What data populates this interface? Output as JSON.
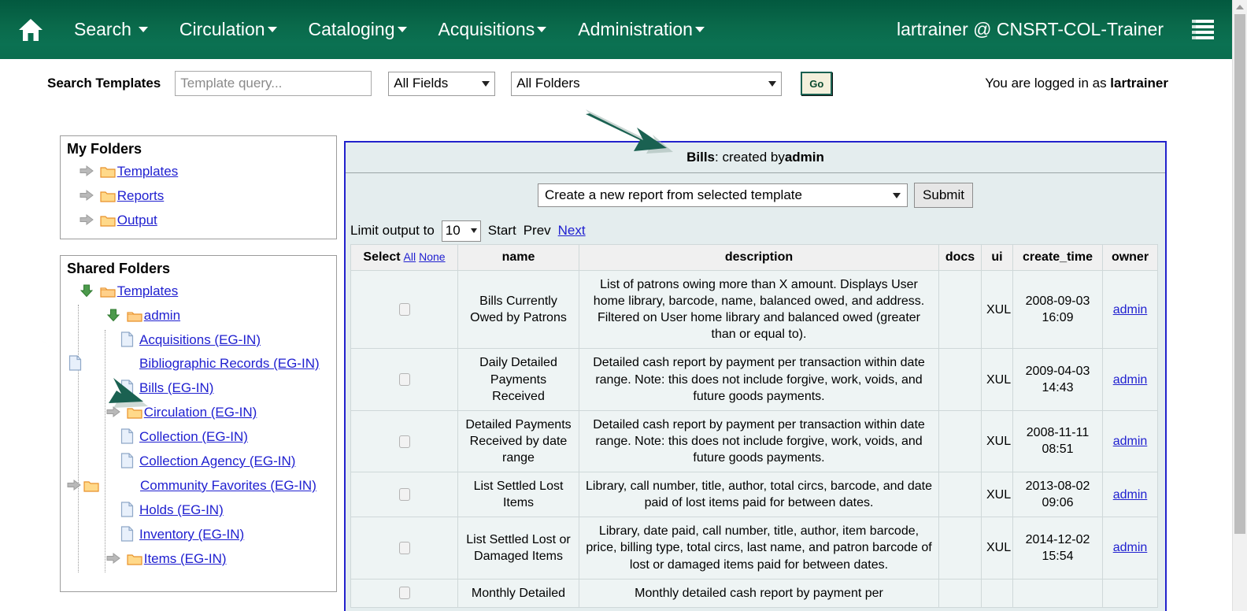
{
  "navbar": {
    "home_icon": "home-icon",
    "menu_icon": "list-menu-icon",
    "items": [
      {
        "label": "Search",
        "has_caret": true
      },
      {
        "label": "Circulation",
        "has_caret": true
      },
      {
        "label": "Cataloging",
        "has_caret": true
      },
      {
        "label": "Acquisitions",
        "has_caret": true
      },
      {
        "label": "Administration",
        "has_caret": true
      }
    ],
    "user": "lartrainer @ CNSRT-COL-Trainer"
  },
  "search": {
    "label": "Search Templates",
    "query_value": "",
    "query_placeholder": "Template query...",
    "fields_select": "All Fields",
    "folders_select": "All Folders",
    "go_label": "Go",
    "logged_in_prefix": "You are logged in as ",
    "logged_in_user": "lartrainer"
  },
  "my_folders": {
    "title": "My Folders",
    "items": [
      {
        "label": "Templates",
        "icon": "folder-icon",
        "toggle": "arrow-right-icon"
      },
      {
        "label": "Reports",
        "icon": "folder-icon",
        "toggle": "arrow-right-icon"
      },
      {
        "label": "Output",
        "icon": "folder-icon",
        "toggle": "arrow-right-icon"
      }
    ]
  },
  "shared_folders": {
    "title": "Shared Folders",
    "items": [
      {
        "label": "Templates",
        "icon": "folder-icon",
        "toggle": "arrow-down-icon",
        "depth": 0
      },
      {
        "label": "admin",
        "icon": "folder-icon",
        "toggle": "arrow-down-icon",
        "depth": 1
      },
      {
        "label": "Acquisitions (EG-IN)",
        "icon": "document-icon",
        "toggle": "none",
        "depth": 2
      },
      {
        "label": "Bibliographic Records (EG-IN)",
        "icon": "document-icon",
        "toggle": "none",
        "depth": 2
      },
      {
        "label": "Bills (EG-IN)",
        "icon": "document-icon",
        "toggle": "none",
        "depth": 2
      },
      {
        "label": "Circulation (EG-IN)",
        "icon": "folder-icon",
        "toggle": "arrow-right-icon",
        "depth": 2
      },
      {
        "label": "Collection (EG-IN)",
        "icon": "document-icon",
        "toggle": "none",
        "depth": 2
      },
      {
        "label": "Collection Agency (EG-IN)",
        "icon": "document-icon",
        "toggle": "none",
        "depth": 2
      },
      {
        "label": "Community Favorites (EG-IN)",
        "icon": "folder-icon",
        "toggle": "arrow-right-icon",
        "depth": 2
      },
      {
        "label": "Holds (EG-IN)",
        "icon": "document-icon",
        "toggle": "none",
        "depth": 2
      },
      {
        "label": "Inventory (EG-IN)",
        "icon": "document-icon",
        "toggle": "none",
        "depth": 2
      },
      {
        "label": "Items (EG-IN)",
        "icon": "folder-icon",
        "toggle": "arrow-right-icon",
        "depth": 2
      }
    ]
  },
  "main": {
    "heading_folder": "Bills",
    "heading_rest": ": created by ",
    "heading_owner": "admin",
    "action_select": "Create a new report from selected template",
    "submit_label": "Submit",
    "limit_label": "Limit output to",
    "limit_value": "10",
    "page_start": "Start",
    "page_prev": "Prev",
    "page_next": "Next",
    "columns": {
      "select": "Select",
      "select_all": "All",
      "select_none": "None",
      "name": "name",
      "description": "description",
      "docs": "docs",
      "ui": "ui",
      "create_time": "create_time",
      "owner": "owner"
    },
    "rows": [
      {
        "name": "Bills Currently Owed by Patrons",
        "description": "List of patrons owing more than X amount. Displays User home library, barcode, name, balanced owed, and address. Filtered on User home library and balanced owed (greater than or equal to).",
        "docs": "",
        "ui": "XUL",
        "create_time": "2008-09-03 16:09",
        "owner": "admin"
      },
      {
        "name": "Daily Detailed Payments Received",
        "description": "Detailed cash report by payment per transaction within date range. Note: this does not include forgive, work, voids, and future goods payments.",
        "docs": "",
        "ui": "XUL",
        "create_time": "2009-04-03 14:43",
        "owner": "admin"
      },
      {
        "name": "Detailed Payments Received by date range",
        "description": "Detailed cash report by payment per transaction within date range. Note: this does not include forgive, work, voids, and future goods payments.",
        "docs": "",
        "ui": "XUL",
        "create_time": "2008-11-11 08:51",
        "owner": "admin"
      },
      {
        "name": "List Settled Lost Items",
        "description": "Library, call number, title, author, total circs, barcode, and date paid of lost items paid for between dates.",
        "docs": "",
        "ui": "XUL",
        "create_time": "2013-08-02 09:06",
        "owner": "admin"
      },
      {
        "name": "List Settled Lost or Damaged Items",
        "description": "Library, date paid, call number, title, author, item barcode, price, billing type, total circs, last name, and patron barcode of lost or damaged items paid for between dates.",
        "docs": "",
        "ui": "XUL",
        "create_time": "2014-12-02 15:54",
        "owner": "admin"
      },
      {
        "name": "Monthly Detailed",
        "description": "Monthly detailed cash report by payment per",
        "docs": "",
        "ui": "",
        "create_time": "",
        "owner": ""
      }
    ]
  },
  "annotations": [
    {
      "name": "arrow-to-heading",
      "color": "#1a6151"
    },
    {
      "name": "arrow-to-bills-template",
      "color": "#1a6151"
    }
  ],
  "colors": {
    "nav_green": "#0a6a4b",
    "panel_bg": "#e4edee",
    "panel_border": "#2222cc",
    "link": "#2020d0",
    "annotation": "#1a6151"
  }
}
